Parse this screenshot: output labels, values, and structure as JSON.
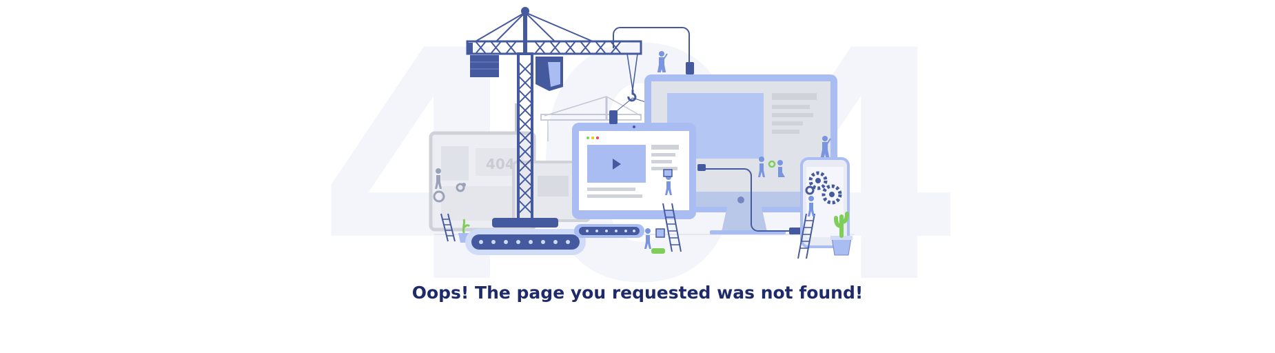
{
  "background_code": "404",
  "message": "Oops! The page you requested was not found!",
  "illustration": {
    "small_screen_text": "404"
  },
  "colors": {
    "navy": "#44599e",
    "light_blue": "#a9bdf2",
    "pale_blue": "#cfdbf7",
    "gray": "#c9cbd1",
    "green": "#7fce5a",
    "text": "#1f2a6b",
    "background_code": "#f3f5fb"
  }
}
